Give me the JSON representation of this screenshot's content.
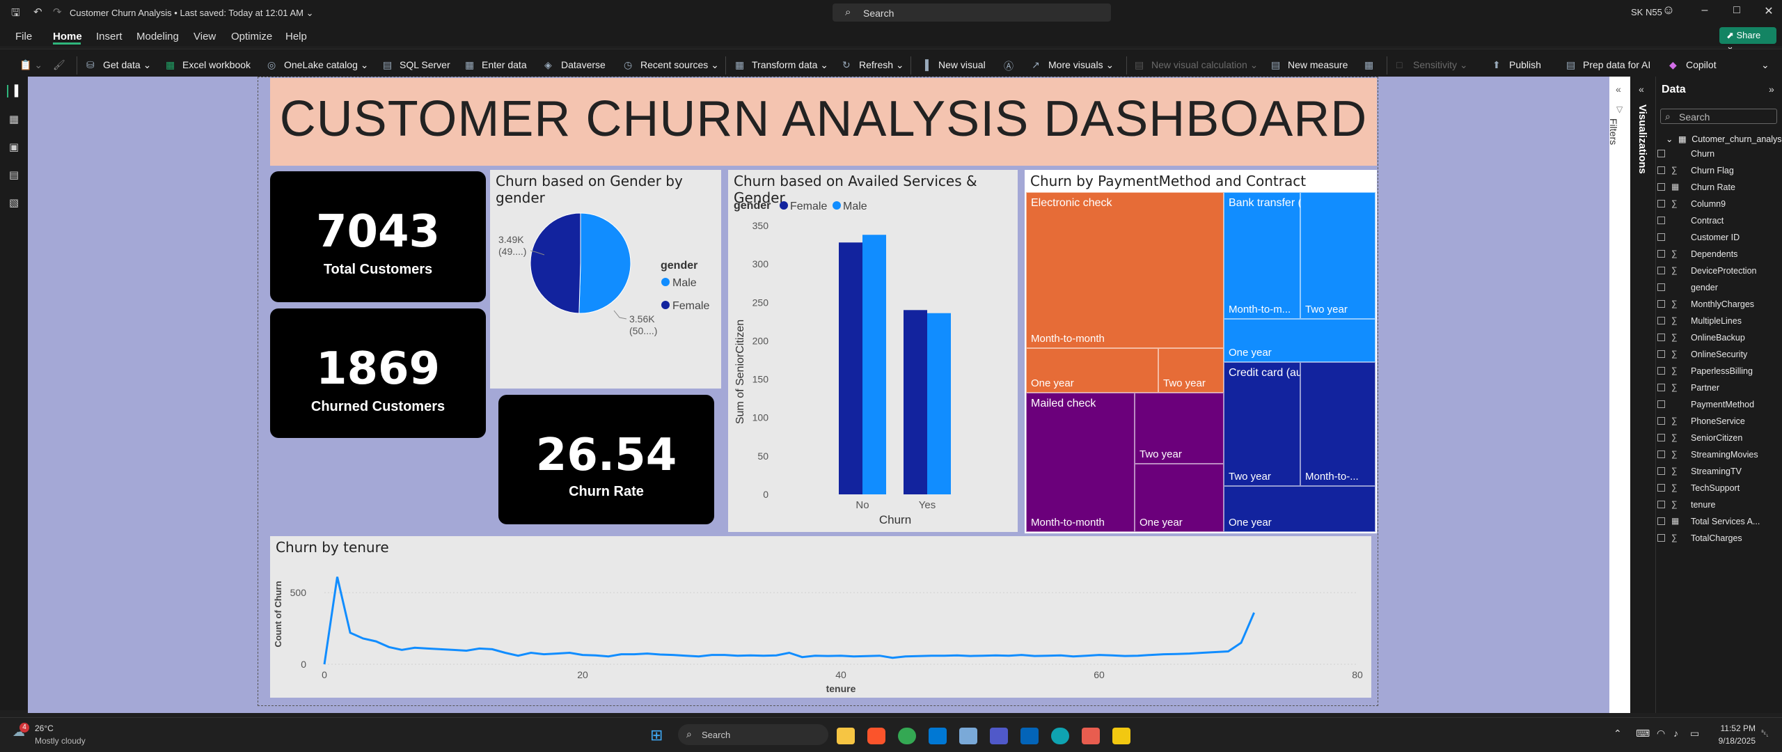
{
  "titlebar": {
    "app_title": "Customer Churn Analysis • Last saved: Today at 12:01 AM ⌄",
    "search_placeholder": "Search",
    "user": "SK N55"
  },
  "menu": {
    "items": [
      "File",
      "Home",
      "Insert",
      "Modeling",
      "View",
      "Optimize",
      "Help"
    ],
    "share": "Share"
  },
  "ribbon": {
    "get_data": "Get data",
    "excel": "Excel workbook",
    "onelake": "OneLake catalog",
    "sql": "SQL Server",
    "enter_data": "Enter data",
    "dataverse": "Dataverse",
    "recent": "Recent sources",
    "transform": "Transform data",
    "refresh": "Refresh",
    "new_visual": "New visual",
    "more_visuals": "More visuals",
    "new_visual_calc": "New visual calculation",
    "new_measure": "New measure",
    "sensitivity": "Sensitivity",
    "publish": "Publish",
    "prep_ai": "Prep data for AI",
    "copilot": "Copilot"
  },
  "dashboard": {
    "title": "CUSTOMER CHURN ANALYSIS DASHBOARD",
    "kpis": [
      {
        "value": "7043",
        "label": "Total Customers"
      },
      {
        "value": "1869",
        "label": "Churned Customers"
      },
      {
        "value": "26.54",
        "label": "Churn Rate"
      }
    ]
  },
  "pie": {
    "title": "Churn based on Gender by gender",
    "legend_title": "gender",
    "legend": [
      {
        "name": "Male",
        "color": "#118dff"
      },
      {
        "name": "Female",
        "color": "#12239e"
      }
    ],
    "label_female_a": "3.49K",
    "label_female_b": "(49....)",
    "label_male_a": "3.56K",
    "label_male_b": "(50....)"
  },
  "bars": {
    "title": "Churn based on Availed Services & Gender",
    "legend_title": "gender",
    "xlabel": "Churn",
    "ylabel": "Sum of SeniorCitizen",
    "yticks": [
      "0",
      "50",
      "100",
      "150",
      "200",
      "250",
      "300",
      "350"
    ]
  },
  "treemap": {
    "title": "Churn by PaymentMethod and Contract",
    "labels": {
      "electronic": "Electronic check",
      "e_m2m": "Month-to-month",
      "e_one": "One year",
      "e_two": "Two year",
      "bank": "Bank transfer (automatic)",
      "b_m2m": "Month-to-m...",
      "b_two": "Two year",
      "b_one": "One year",
      "mailed": "Mailed check",
      "m_m2m": "Month-to-month",
      "m_two": "Two year",
      "m_one": "One year",
      "credit": "Credit card (automatic)",
      "c_two": "Two year",
      "c_m2m": "Month-to-...",
      "c_one": "One year"
    }
  },
  "line": {
    "title": "Churn by tenure",
    "xlabel": "tenure",
    "ylabel": "Count of Churn"
  },
  "chart_data": [
    {
      "type": "pie",
      "title": "Churn based on Gender by gender",
      "categories": [
        "Male",
        "Female"
      ],
      "values": [
        3555,
        3488
      ],
      "colors": [
        "#118dff",
        "#12239e"
      ]
    },
    {
      "type": "bar",
      "title": "Churn based on Availed Services & Gender",
      "categories": [
        "No",
        "Yes"
      ],
      "series": [
        {
          "name": "Female",
          "values": [
            328,
            240
          ],
          "color": "#12239e"
        },
        {
          "name": "Male",
          "values": [
            338,
            236
          ],
          "color": "#118dff"
        }
      ],
      "xlabel": "Churn",
      "ylabel": "Sum of SeniorCitizen",
      "ylim": [
        0,
        350
      ]
    },
    {
      "type": "treemap",
      "title": "Churn by PaymentMethod and Contract",
      "groups": [
        {
          "name": "Electronic check",
          "color": "#e66c37",
          "items": [
            "Month-to-month",
            "One year",
            "Two year"
          ]
        },
        {
          "name": "Bank transfer (automatic)",
          "color": "#118dff",
          "items": [
            "Month-to-m...",
            "Two year",
            "One year"
          ]
        },
        {
          "name": "Mailed check",
          "color": "#6b007b",
          "items": [
            "Month-to-month",
            "Two year",
            "One year"
          ]
        },
        {
          "name": "Credit card (automatic)",
          "color": "#12239e",
          "items": [
            "Two year",
            "Month-to-...",
            "One year"
          ]
        }
      ]
    },
    {
      "type": "line",
      "title": "Churn by tenure",
      "xlabel": "tenure",
      "ylabel": "Count of Churn",
      "xlim": [
        0,
        80
      ],
      "ylim": [
        0,
        700
      ],
      "xticks": [
        0,
        20,
        40,
        60,
        80
      ],
      "yticks": [
        0,
        500
      ],
      "x": [
        0,
        1,
        2,
        3,
        4,
        5,
        6,
        7,
        8,
        9,
        10,
        11,
        12,
        13,
        14,
        15,
        16,
        17,
        18,
        19,
        20,
        21,
        22,
        23,
        24,
        25,
        26,
        27,
        28,
        29,
        30,
        31,
        32,
        33,
        34,
        35,
        36,
        37,
        38,
        39,
        40,
        41,
        42,
        43,
        44,
        45,
        46,
        47,
        48,
        49,
        50,
        51,
        52,
        53,
        54,
        55,
        56,
        57,
        58,
        59,
        60,
        61,
        62,
        63,
        64,
        65,
        66,
        67,
        68,
        69,
        70,
        71,
        72
      ],
      "y": [
        0,
        610,
        220,
        180,
        160,
        120,
        100,
        115,
        110,
        105,
        100,
        95,
        110,
        105,
        80,
        60,
        80,
        70,
        75,
        80,
        65,
        62,
        55,
        70,
        70,
        75,
        68,
        65,
        60,
        55,
        65,
        65,
        60,
        62,
        60,
        62,
        80,
        50,
        60,
        58,
        60,
        55,
        57,
        60,
        45,
        55,
        57,
        60,
        60,
        62,
        58,
        60,
        62,
        60,
        65,
        58,
        60,
        62,
        55,
        60,
        65,
        62,
        58,
        60,
        65,
        70,
        72,
        75,
        80,
        85,
        90,
        150,
        360
      ],
      "color": "#118dff"
    }
  ],
  "data_pane": {
    "title": "Data",
    "search": "Search",
    "table": "Cutomer_churn_analysis",
    "fields": [
      {
        "name": "Churn",
        "sigma": ""
      },
      {
        "name": "Churn Flag",
        "sigma": "∑"
      },
      {
        "name": "Churn Rate",
        "sigma": "▦"
      },
      {
        "name": "Column9",
        "sigma": "∑"
      },
      {
        "name": "Contract",
        "sigma": ""
      },
      {
        "name": "Customer ID",
        "sigma": ""
      },
      {
        "name": "Dependents",
        "sigma": "∑"
      },
      {
        "name": "DeviceProtection",
        "sigma": "∑"
      },
      {
        "name": "gender",
        "sigma": ""
      },
      {
        "name": "MonthlyCharges",
        "sigma": "∑"
      },
      {
        "name": "MultipleLines",
        "sigma": "∑"
      },
      {
        "name": "OnlineBackup",
        "sigma": "∑"
      },
      {
        "name": "OnlineSecurity",
        "sigma": "∑"
      },
      {
        "name": "PaperlessBilling",
        "sigma": "∑"
      },
      {
        "name": "Partner",
        "sigma": "∑"
      },
      {
        "name": "PaymentMethod",
        "sigma": ""
      },
      {
        "name": "PhoneService",
        "sigma": "∑"
      },
      {
        "name": "SeniorCitizen",
        "sigma": "∑"
      },
      {
        "name": "StreamingMovies",
        "sigma": "∑"
      },
      {
        "name": "StreamingTV",
        "sigma": "∑"
      },
      {
        "name": "TechSupport",
        "sigma": "∑"
      },
      {
        "name": "tenure",
        "sigma": "∑"
      },
      {
        "name": "Total Services A...",
        "sigma": "▦"
      },
      {
        "name": "TotalCharges",
        "sigma": "∑"
      }
    ]
  },
  "side_tabs": {
    "filters": "Filters",
    "visualizations": "Visualizations"
  },
  "taskbar": {
    "temp": "26°C",
    "weather": "Mostly cloudy",
    "search": "Search",
    "time": "11:52 PM",
    "date": "9/18/2025",
    "badge": "4"
  }
}
